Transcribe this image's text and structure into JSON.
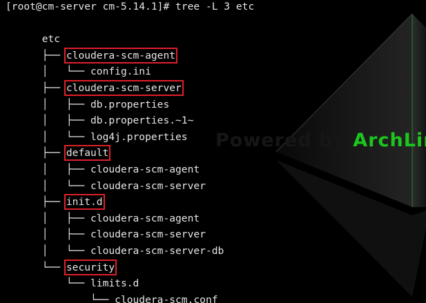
{
  "terminal": {
    "prompt": "[root@cm-server cm-5.14.1]# tree -L 3 etc",
    "lines": [
      {
        "prefix": "",
        "name": "etc"
      },
      {
        "prefix": "├── ",
        "name": "cloudera-scm-agent"
      },
      {
        "prefix": "│   └── ",
        "name": "config.ini"
      },
      {
        "prefix": "├── ",
        "name": "cloudera-scm-server"
      },
      {
        "prefix": "│   ├── ",
        "name": "db.properties"
      },
      {
        "prefix": "│   ├── ",
        "name": "db.properties.~1~"
      },
      {
        "prefix": "│   └── ",
        "name": "log4j.properties"
      },
      {
        "prefix": "├── ",
        "name": "default"
      },
      {
        "prefix": "│   ├── ",
        "name": "cloudera-scm-agent"
      },
      {
        "prefix": "│   └── ",
        "name": "cloudera-scm-server"
      },
      {
        "prefix": "├── ",
        "name": "init.d"
      },
      {
        "prefix": "│   ├── ",
        "name": "cloudera-scm-agent"
      },
      {
        "prefix": "│   ├── ",
        "name": "cloudera-scm-server"
      },
      {
        "prefix": "│   └── ",
        "name": "cloudera-scm-server-db"
      },
      {
        "prefix": "└── ",
        "name": "security"
      },
      {
        "prefix": "    └── ",
        "name": "limits.d"
      },
      {
        "prefix": "        └── ",
        "name": "cloudera-scm.conf"
      }
    ]
  },
  "watermark": {
    "text": "Powered by ",
    "brand": "ArchLinux"
  },
  "colors": {
    "background": "#000000",
    "text": "#e6e6e6",
    "highlight_box": "#e0202a",
    "brand_green": "#1ec51e"
  }
}
